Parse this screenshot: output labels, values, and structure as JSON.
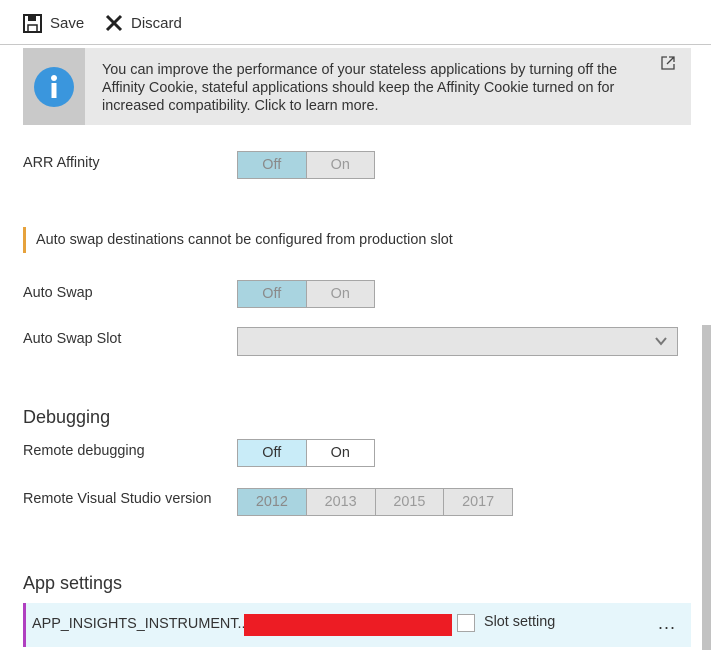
{
  "toolbar": {
    "save_label": "Save",
    "discard_label": "Discard"
  },
  "info": {
    "message": "You can improve the performance of your stateless applications by turning off the Affinity Cookie, stateful applications should keep the Affinity Cookie turned on for increased compatibility. Click to learn more."
  },
  "arr_affinity": {
    "label": "ARR Affinity",
    "options": [
      "Off",
      "On"
    ],
    "selected": "Off"
  },
  "auto_swap_warning": "Auto swap destinations cannot be configured from production slot",
  "auto_swap": {
    "label": "Auto Swap",
    "options": [
      "Off",
      "On"
    ],
    "selected": "Off"
  },
  "auto_swap_slot": {
    "label": "Auto Swap Slot",
    "value": ""
  },
  "debugging": {
    "title": "Debugging",
    "remote_debugging": {
      "label": "Remote debugging",
      "options": [
        "Off",
        "On"
      ],
      "selected": "Off"
    },
    "vs_version": {
      "label": "Remote Visual Studio version",
      "options": [
        "2012",
        "2013",
        "2015",
        "2017"
      ],
      "selected": "2012"
    }
  },
  "app_settings": {
    "title": "App settings",
    "rows": [
      {
        "name": "APP_INSIGHTS_INSTRUMENT..",
        "slot_setting_label": "Slot setting",
        "more": "..."
      }
    ]
  }
}
